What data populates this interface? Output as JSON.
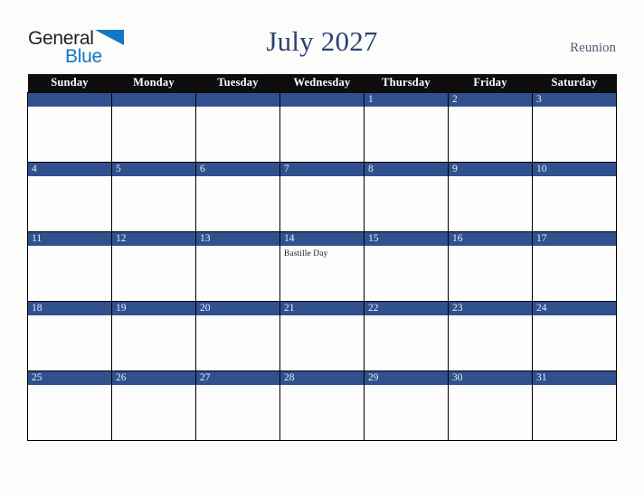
{
  "brand": {
    "word_one": "General",
    "word_two": "Blue",
    "triangle_icon": "blue-triangle-icon",
    "color_dark": "#231f20",
    "color_blue": "#1277c4"
  },
  "header": {
    "title": "July 2027",
    "region": "Reunion",
    "title_color": "#2c4370",
    "region_color": "#4a5d80"
  },
  "calendar": {
    "month": "July",
    "year": "2027",
    "accent_band_color": "#30518e",
    "header_bar_color": "#0d0d0d",
    "weekday_headers": [
      "Sunday",
      "Monday",
      "Tuesday",
      "Wednesday",
      "Thursday",
      "Friday",
      "Saturday"
    ],
    "weeks": [
      [
        {
          "day": "",
          "event": ""
        },
        {
          "day": "",
          "event": ""
        },
        {
          "day": "",
          "event": ""
        },
        {
          "day": "",
          "event": ""
        },
        {
          "day": "1",
          "event": ""
        },
        {
          "day": "2",
          "event": ""
        },
        {
          "day": "3",
          "event": ""
        }
      ],
      [
        {
          "day": "4",
          "event": ""
        },
        {
          "day": "5",
          "event": ""
        },
        {
          "day": "6",
          "event": ""
        },
        {
          "day": "7",
          "event": ""
        },
        {
          "day": "8",
          "event": ""
        },
        {
          "day": "9",
          "event": ""
        },
        {
          "day": "10",
          "event": ""
        }
      ],
      [
        {
          "day": "11",
          "event": ""
        },
        {
          "day": "12",
          "event": ""
        },
        {
          "day": "13",
          "event": ""
        },
        {
          "day": "14",
          "event": "Bastille Day"
        },
        {
          "day": "15",
          "event": ""
        },
        {
          "day": "16",
          "event": ""
        },
        {
          "day": "17",
          "event": ""
        }
      ],
      [
        {
          "day": "18",
          "event": ""
        },
        {
          "day": "19",
          "event": ""
        },
        {
          "day": "20",
          "event": ""
        },
        {
          "day": "21",
          "event": ""
        },
        {
          "day": "22",
          "event": ""
        },
        {
          "day": "23",
          "event": ""
        },
        {
          "day": "24",
          "event": ""
        }
      ],
      [
        {
          "day": "25",
          "event": ""
        },
        {
          "day": "26",
          "event": ""
        },
        {
          "day": "27",
          "event": ""
        },
        {
          "day": "28",
          "event": ""
        },
        {
          "day": "29",
          "event": ""
        },
        {
          "day": "30",
          "event": ""
        },
        {
          "day": "31",
          "event": ""
        }
      ]
    ]
  }
}
